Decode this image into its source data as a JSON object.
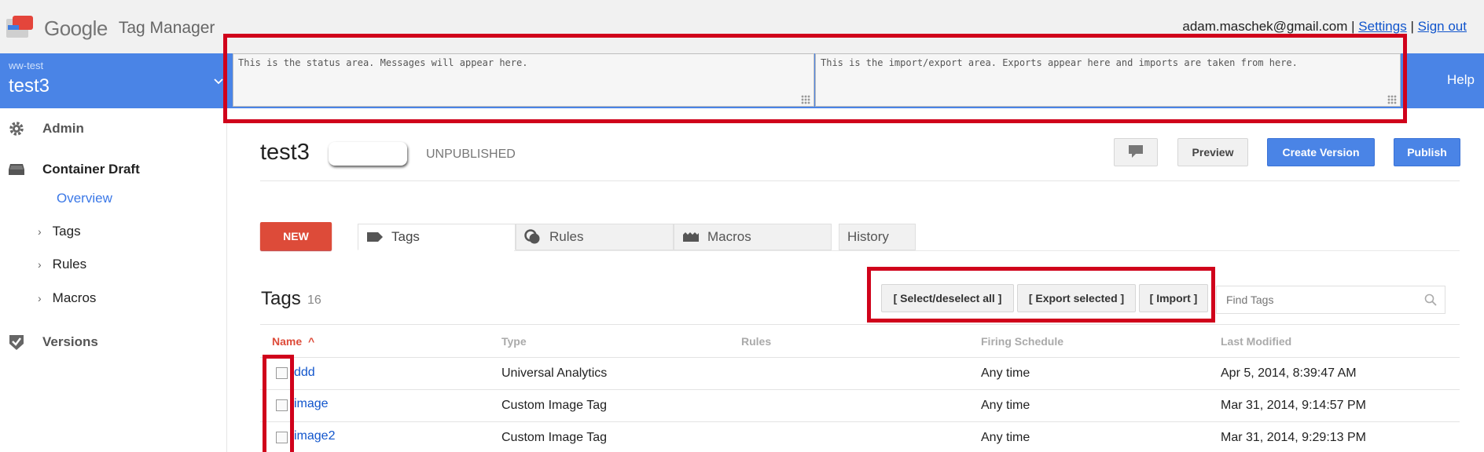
{
  "header": {
    "logo_google": "Google",
    "logo_product": "Tag Manager",
    "user_email": "adam.maschek@gmail.com",
    "separator": "|",
    "settings_link": "Settings",
    "signout_link": "Sign out"
  },
  "account": {
    "label": "ww-test",
    "container": "test3",
    "help": "Help"
  },
  "status_area": "This is the status area. Messages will appear here.",
  "io_area": "This is the import/export area. Exports appear here and imports are taken from here.",
  "sidebar": {
    "admin": "Admin",
    "container_draft": "Container Draft",
    "overview": "Overview",
    "tags": "Tags",
    "rules": "Rules",
    "macros": "Macros",
    "versions": "Versions",
    "caret": "›"
  },
  "page": {
    "title": "test3",
    "status": "UNPUBLISHED",
    "preview": "Preview",
    "create_version": "Create Version",
    "publish": "Publish"
  },
  "tabs": {
    "new_button": "NEW",
    "items": [
      {
        "label": "Tags",
        "icon": "tag-icon"
      },
      {
        "label": "Rules",
        "icon": "rules-icon"
      },
      {
        "label": "Macros",
        "icon": "macros-icon"
      },
      {
        "label": "History",
        "icon": ""
      }
    ]
  },
  "tags_section": {
    "title": "Tags",
    "count": "16",
    "select_all": "[ Select/deselect all ]",
    "export_selected": "[ Export selected ]",
    "import": "[ Import ]",
    "search_placeholder": "Find Tags"
  },
  "table": {
    "columns": [
      "Name",
      "Type",
      "Rules",
      "Firing Schedule",
      "Last Modified"
    ],
    "sort_indicator": "^",
    "rows": [
      {
        "name": "ddd",
        "type": "Universal Analytics",
        "rules": "",
        "schedule": "Any time",
        "modified": "Apr 5, 2014, 8:39:47 AM"
      },
      {
        "name": "image",
        "type": "Custom Image Tag",
        "rules": "",
        "schedule": "Any time",
        "modified": "Mar 31, 2014, 9:14:57 PM"
      },
      {
        "name": "image2",
        "type": "Custom Image Tag",
        "rules": "",
        "schedule": "Any time",
        "modified": "Mar 31, 2014, 9:29:13 PM"
      }
    ]
  },
  "colors": {
    "brand_blue": "#4a84e6",
    "new_red": "#dd4b39",
    "highlight_red": "#d0021b",
    "link_blue": "#1155cc"
  }
}
